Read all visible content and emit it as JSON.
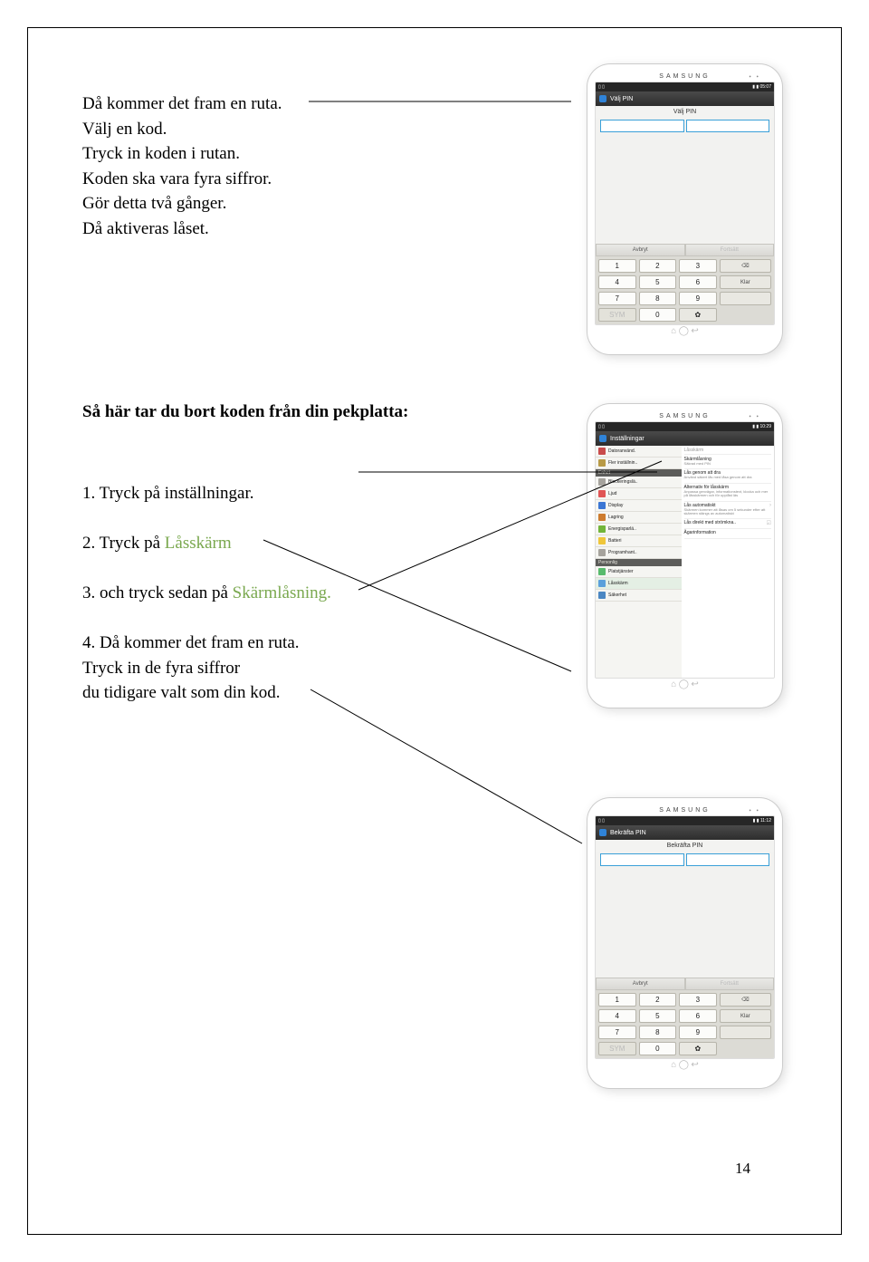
{
  "page_number": "14",
  "block1": {
    "l1": "Då kommer det fram en ruta.",
    "l2": "Välj en kod.",
    "l3": "Tryck in koden i rutan.",
    "l4": "Koden ska vara fyra siffror.",
    "l5": "Gör detta två gånger.",
    "l6": "Då aktiveras låset."
  },
  "heading2": "Så här tar du bort koden från din pekplatta:",
  "steps": {
    "s1": "1. Tryck på inställningar.",
    "s2a": "2. Tryck på ",
    "s2b": "Låsskärm",
    "s3a": "3. och tryck sedan på ",
    "s3b": "Skärmlåsning.",
    "s4a": "4. Då kommer det fram en ruta.",
    "s4b": "Tryck in de fyra siffror",
    "s4c": "du tidigare valt som din kod."
  },
  "tablet": {
    "brand": "SAMSUNG",
    "hw_icons": "⌂     ◯     ↩",
    "pin_screen": {
      "status_left": "▯ ▯",
      "status_right": "▮ ▮ 05:07",
      "title": "Välj PIN",
      "subtitle": "Välj PIN",
      "btn_cancel": "Avbryt",
      "btn_ok": "Fortsätt",
      "key_klar": "Klar",
      "key_sym": "SYM",
      "key_back": "⌫",
      "key_gear": "✿",
      "digits": [
        "1",
        "2",
        "3",
        "4",
        "5",
        "6",
        "7",
        "8",
        "9",
        "0"
      ]
    },
    "settings_screen": {
      "status_right": "▮ ▮ 10:29",
      "title": "Inställningar",
      "sections": {
        "enhet": "Enhet",
        "personlig": "Personlig"
      },
      "sidebar": [
        {
          "label": "Datoranvänd.",
          "color": "#c94c4c"
        },
        {
          "label": "Fler inställnin..",
          "color": "#b89a46"
        },
        {
          "label": "Blockeringslä..",
          "color": "#a6a39d"
        },
        {
          "label": "Ljud",
          "color": "#e05555"
        },
        {
          "label": "Display",
          "color": "#3b76d4"
        },
        {
          "label": "Lagring",
          "color": "#ce7c2f"
        },
        {
          "label": "Energisparlä..",
          "color": "#72b53a"
        },
        {
          "label": "Batteri",
          "color": "#efc63a"
        },
        {
          "label": "Programhant..",
          "color": "#a6a39d"
        },
        {
          "label": "Platstjänster",
          "color": "#58bb6d"
        },
        {
          "label": "Låsskärm",
          "color": "#5aa0db",
          "selected": true
        },
        {
          "label": "Säkerhet",
          "color": "#4b87c3"
        }
      ],
      "rp_head": "Låsskärm",
      "rp_items": [
        {
          "title": "Skärmlåsning",
          "desc": "Säkrad med PIN"
        },
        {
          "title": "Lås genom att dra",
          "desc": "Använd säkert lås med låsa genom att dra"
        },
        {
          "title": "Alternativ för låsskärm",
          "desc": "Anpassa genvägar, informationstext, klocka och mer på låsskärmen och för upplåst läs"
        },
        {
          "title": "Lås automatiskt",
          "desc": "Skärmen kommer att låsas om 5 sekunder efter att skärmen stängs av automatiskt",
          "arrow": "›"
        },
        {
          "title": "Lås direkt med strömkna..",
          "desc": "",
          "check": "☑"
        },
        {
          "title": "Ägarinformation",
          "desc": ""
        }
      ]
    },
    "confirm_screen": {
      "status_right": "▮ ▮ 11:12",
      "title": "Bekräfta PIN",
      "subtitle": "Bekräfta PIN",
      "btn_cancel": "Avbryt"
    }
  }
}
